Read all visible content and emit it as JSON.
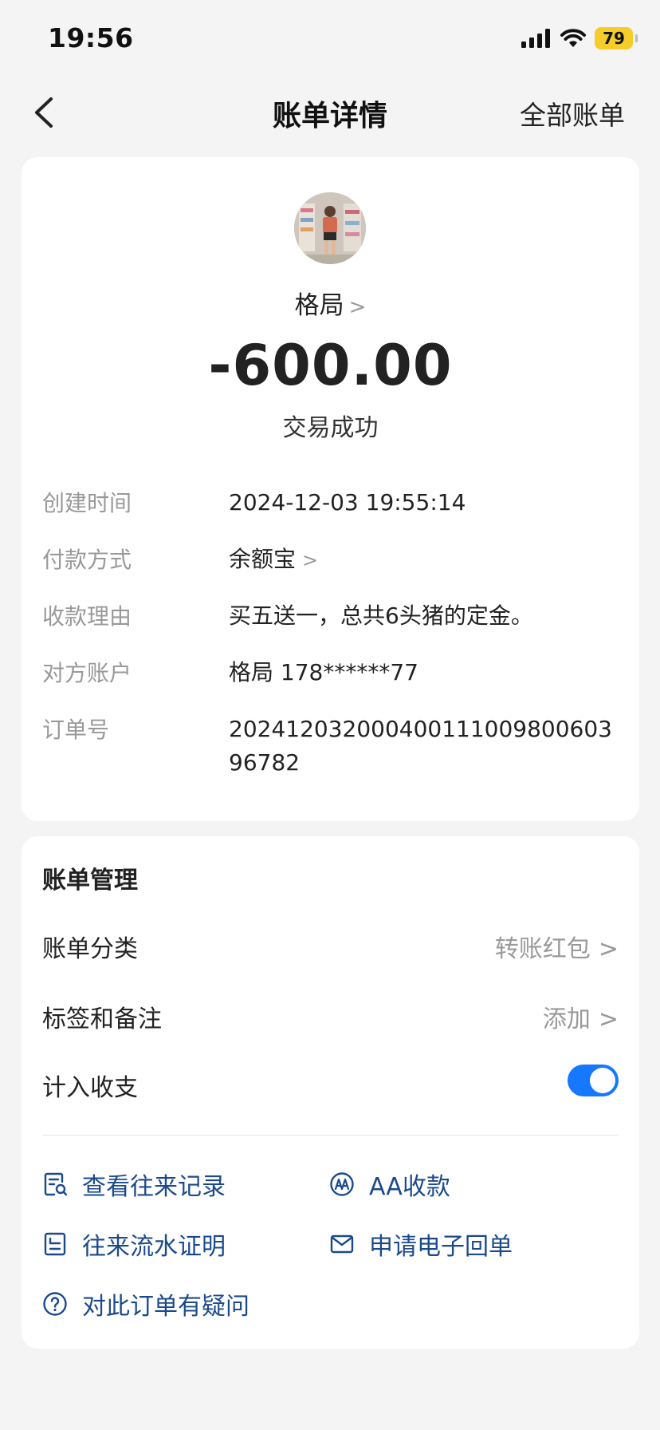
{
  "status_bar": {
    "time": "19:56",
    "battery": "79"
  },
  "nav": {
    "title": "账单详情",
    "right_action": "全部账单"
  },
  "summary": {
    "payee_name": "格局",
    "amount": "-600.00",
    "status": "交易成功"
  },
  "details": [
    {
      "label": "创建时间",
      "value": "2024-12-03 19:55:14"
    },
    {
      "label": "付款方式",
      "value": "余额宝"
    },
    {
      "label": "收款理由",
      "value": "买五送一，总共6头猪的定金。"
    },
    {
      "label": "对方账户",
      "value": "格局 178******77"
    },
    {
      "label": "订单号",
      "value": "20241203200040011100980060396782"
    }
  ],
  "management": {
    "title": "账单管理",
    "category_label": "账单分类",
    "category_value": "转账红包",
    "tags_label": "标签和备注",
    "tags_value": "添加",
    "include_label": "计入收支",
    "include_enabled": true
  },
  "actions": {
    "view_records": "查看往来记录",
    "aa_collect": "AA收款",
    "flow_proof": "往来流水证明",
    "e_receipt": "申请电子回单",
    "question": "对此订单有疑问"
  },
  "colors": {
    "accent": "#1677ff",
    "link": "#1b4a8c",
    "label_gray": "#999999",
    "battery": "#f5cc2a"
  }
}
